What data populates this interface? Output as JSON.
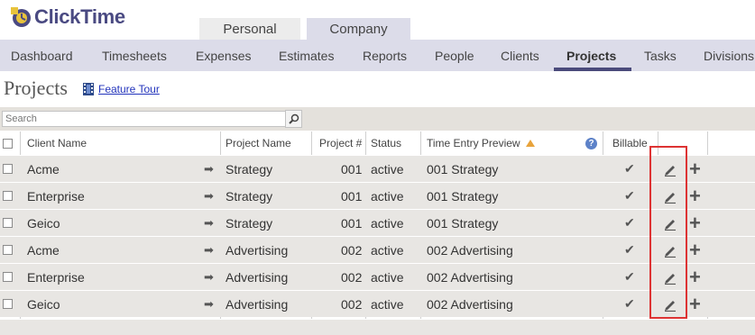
{
  "app": {
    "logo_text": "ClickTime"
  },
  "top_tabs": [
    {
      "label": "Personal"
    },
    {
      "label": "Company"
    }
  ],
  "nav": [
    {
      "label": "Dashboard"
    },
    {
      "label": "Timesheets"
    },
    {
      "label": "Expenses"
    },
    {
      "label": "Estimates"
    },
    {
      "label": "Reports"
    },
    {
      "label": "People"
    },
    {
      "label": "Clients"
    },
    {
      "label": "Projects"
    },
    {
      "label": "Tasks"
    },
    {
      "label": "Divisions"
    }
  ],
  "page": {
    "title": "Projects",
    "feature_tour": "Feature Tour"
  },
  "search": {
    "placeholder": "Search"
  },
  "table": {
    "headers": {
      "client": "Client Name",
      "project": "Project Name",
      "number": "Project #",
      "status": "Status",
      "preview": "Time Entry Preview",
      "help": "?",
      "billable": "Billable"
    },
    "rows": [
      {
        "client": "Acme",
        "project": "Strategy",
        "number": "001",
        "status": "active",
        "preview": "001 Strategy",
        "billable": true
      },
      {
        "client": "Enterprise",
        "project": "Strategy",
        "number": "001",
        "status": "active",
        "preview": "001 Strategy",
        "billable": true
      },
      {
        "client": "Geico",
        "project": "Strategy",
        "number": "001",
        "status": "active",
        "preview": "001 Strategy",
        "billable": true
      },
      {
        "client": "Acme",
        "project": "Advertising",
        "number": "002",
        "status": "active",
        "preview": "002 Advertising",
        "billable": true
      },
      {
        "client": "Enterprise",
        "project": "Advertising",
        "number": "002",
        "status": "active",
        "preview": "002 Advertising",
        "billable": true
      },
      {
        "client": "Geico",
        "project": "Advertising",
        "number": "002",
        "status": "active",
        "preview": "002 Advertising",
        "billable": true
      }
    ]
  },
  "icons": {
    "arrow": "arrow-right-icon",
    "check": "checkmark-icon",
    "edit": "pencil-icon",
    "add": "plus-icon",
    "search": "magnifier-icon",
    "sort": "sort-ascending-icon"
  },
  "colors": {
    "brand": "#4a4a82",
    "nav_bg": "#dcdce9",
    "active_underline": "#4b4b7b",
    "highlight": "#dd3333",
    "row_bg": "#e8e6e3"
  }
}
